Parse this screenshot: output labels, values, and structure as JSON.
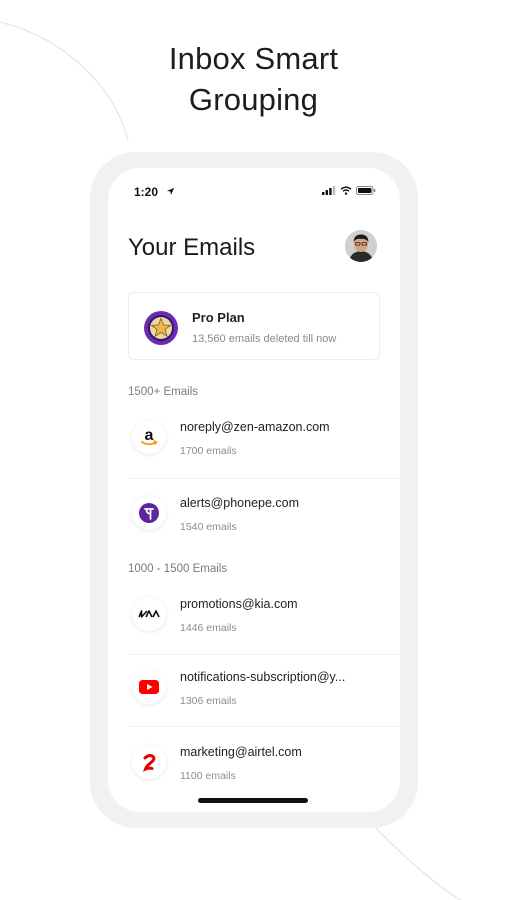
{
  "headline": {
    "line1": "Inbox Smart",
    "line2": "Grouping"
  },
  "status_bar": {
    "time": "1:20"
  },
  "page": {
    "title": "Your Emails"
  },
  "plan": {
    "name": "Pro Plan",
    "subtitle": "13,560 emails deleted till now"
  },
  "sections": [
    {
      "label": "1500+ Emails",
      "items": [
        {
          "email": "noreply@zen-amazon.com",
          "count": "1700 emails",
          "logo_text": "a",
          "icon": "amazon-logo-icon"
        },
        {
          "email": "alerts@phonepe.com",
          "count": "1540 emails",
          "logo_text": "पे",
          "icon": "phonepe-logo-icon"
        }
      ]
    },
    {
      "label": "1000 - 1500 Emails",
      "items": [
        {
          "email": "promotions@kia.com",
          "count": "1446 emails",
          "logo_text": "KIA",
          "icon": "kia-logo-icon"
        },
        {
          "email": "notifications-subscription@y...",
          "count": "1306 emails",
          "icon": "youtube-logo-icon"
        },
        {
          "email": "marketing@airtel.com",
          "count": "1100 emails",
          "icon": "airtel-logo-icon"
        }
      ]
    }
  ],
  "colors": {
    "phonepe": "#5f259f",
    "youtube": "#ff0000",
    "airtel": "#e40000",
    "amazon_smile": "#f79400",
    "plan_badge_ring": "#6c2bb3",
    "plan_badge_star": "#e9b949"
  }
}
